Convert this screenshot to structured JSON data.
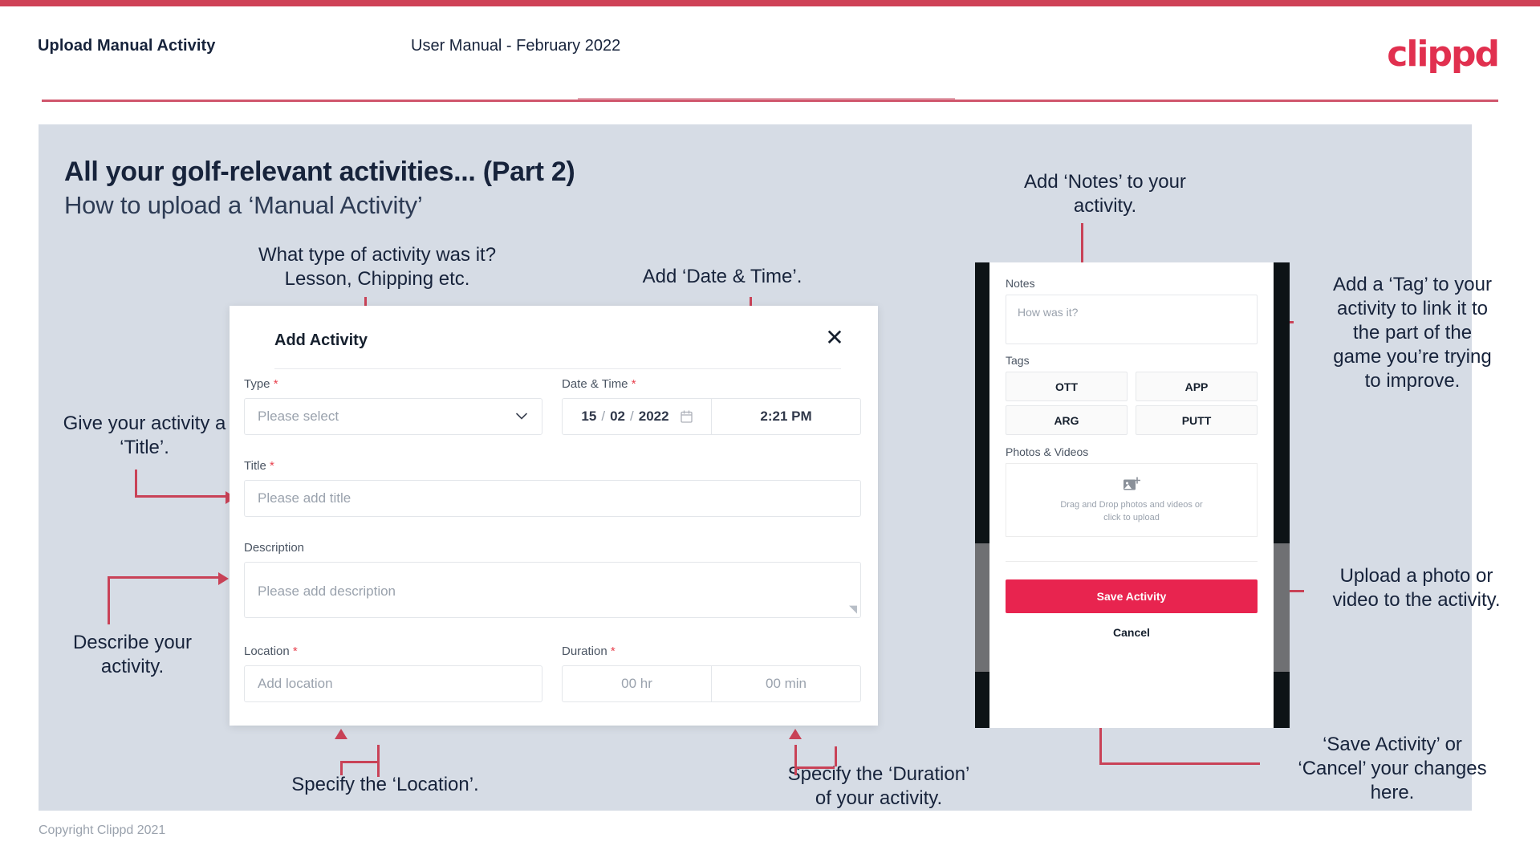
{
  "header": {
    "left_title": "Upload Manual Activity",
    "center_title": "User Manual - February 2022",
    "logo": "clippd",
    "accent": "#cf4257"
  },
  "slide": {
    "heading": "All your golf-relevant activities... (Part 2)",
    "subheading": "How to upload a ‘Manual Activity’",
    "background": "#d6dce5"
  },
  "annotations": {
    "type": "What type of activity was it?\nLesson, Chipping etc.",
    "datetime": "Add ‘Date & Time’.",
    "title": "Give your activity a\n‘Title’.",
    "description": "Describe your\nactivity.",
    "location": "Specify the ‘Location’.",
    "duration": "Specify the ‘Duration’\nof your activity.",
    "notes": "Add ‘Notes’ to your\nactivity.",
    "tags": "Add a ‘Tag’ to your\nactivity to link it to\nthe part of the\ngame you’re trying\nto improve.",
    "photos": "Upload a photo or\nvideo to the activity.",
    "save": "‘Save Activity’ or\n‘Cancel’ your changes\nhere."
  },
  "modal": {
    "title": "Add Activity",
    "close_icon": "close-icon",
    "fields": {
      "type": {
        "label": "Type",
        "required": true,
        "placeholder": "Please select",
        "icon": "chevron-down-icon"
      },
      "datetime": {
        "label": "Date & Time",
        "required": true,
        "day": "15",
        "sep1": "/",
        "month": "02",
        "sep2": "/",
        "year": "2022",
        "calendar_icon": "calendar-icon",
        "time": "2:21 PM"
      },
      "title": {
        "label": "Title",
        "required": true,
        "placeholder": "Please add title"
      },
      "description": {
        "label": "Description",
        "required": false,
        "placeholder": "Please add description"
      },
      "location": {
        "label": "Location",
        "required": true,
        "placeholder": "Add location"
      },
      "duration": {
        "label": "Duration",
        "required": true,
        "hours": "00 hr",
        "minutes": "00 min"
      }
    },
    "required_marker": "*"
  },
  "phone": {
    "notes": {
      "label": "Notes",
      "placeholder": "How was it?"
    },
    "tags": {
      "label": "Tags",
      "items": [
        "OTT",
        "APP",
        "ARG",
        "PUTT"
      ]
    },
    "photos": {
      "label": "Photos & Videos",
      "icon": "add-image-icon",
      "hint_line1": "Drag and Drop photos and videos or",
      "hint_line2": "click to upload"
    },
    "save_label": "Save Activity",
    "cancel_label": "Cancel",
    "save_color": "#e8244f"
  },
  "footer": {
    "copyright": "Copyright Clippd 2021"
  }
}
